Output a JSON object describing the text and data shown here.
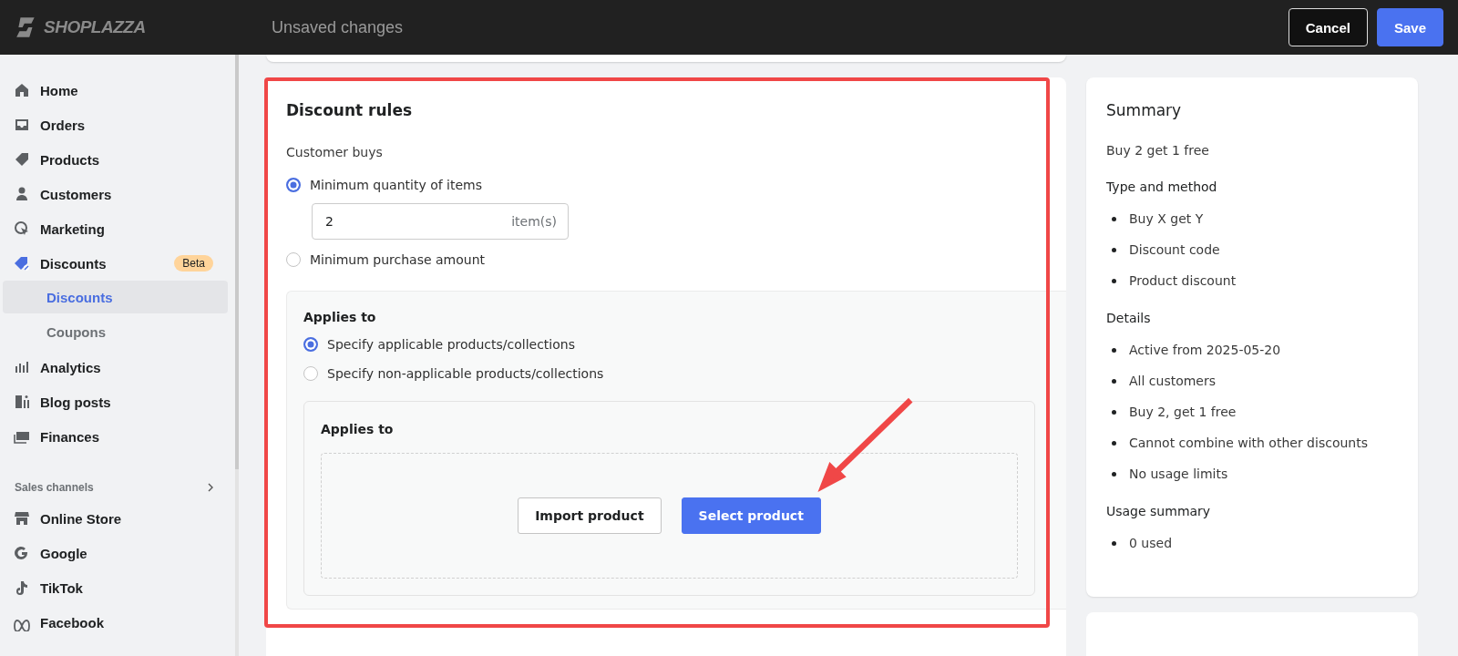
{
  "header": {
    "logo": "SHOPLAZZA",
    "title": "Unsaved changes",
    "buttons": [
      {
        "label": "Cancel",
        "kind": "secondary"
      },
      {
        "label": "Save",
        "kind": "primary"
      }
    ]
  },
  "sidebar": {
    "items": [
      {
        "label": "Home"
      },
      {
        "label": "Orders"
      },
      {
        "label": "Products"
      },
      {
        "label": "Customers"
      },
      {
        "label": "Marketing"
      },
      {
        "label": "Discounts",
        "badge": "Beta",
        "children": [
          {
            "label": "Discounts",
            "selected": true
          },
          {
            "label": "Coupons",
            "selected": false
          }
        ]
      },
      {
        "label": "Analytics"
      },
      {
        "label": "Blog posts"
      },
      {
        "label": "Finances"
      }
    ],
    "section": {
      "title": "Sales channels",
      "items": [
        {
          "label": "Online Store"
        },
        {
          "label": "Google"
        },
        {
          "label": "TikTok"
        },
        {
          "label": "Facebook"
        }
      ]
    }
  },
  "discount_rules": {
    "title": "Discount rules",
    "customer_buys": {
      "label": "Customer buys",
      "options": [
        {
          "label": "Minimum quantity of items",
          "selected": true,
          "field": {
            "value": "2",
            "suffix": "item(s)"
          }
        },
        {
          "label": "Minimum purchase amount",
          "selected": false
        }
      ]
    },
    "applies_to": {
      "title": "Applies to",
      "options": [
        {
          "label": "Specify applicable products/collections",
          "selected": true
        },
        {
          "label": "Specify non-applicable products/collections",
          "selected": false
        }
      ],
      "panel": {
        "title": "Applies to",
        "buttons": [
          {
            "label": "Import product",
            "kind": "secondary"
          },
          {
            "label": "Select product",
            "kind": "primary"
          }
        ]
      }
    }
  },
  "summary": {
    "title": "Summary",
    "name": "Buy 2 get 1 free",
    "sections": [
      {
        "heading": "Type and method",
        "items": [
          "Buy X get Y",
          "Discount code",
          "Product discount"
        ]
      },
      {
        "heading": "Details",
        "items": [
          "Active from 2025-05-20",
          "All customers",
          "Buy 2, get 1 free",
          "Cannot combine with other discounts",
          "No usage limits"
        ]
      },
      {
        "heading": "Usage summary",
        "items": [
          "0 used"
        ]
      }
    ]
  }
}
